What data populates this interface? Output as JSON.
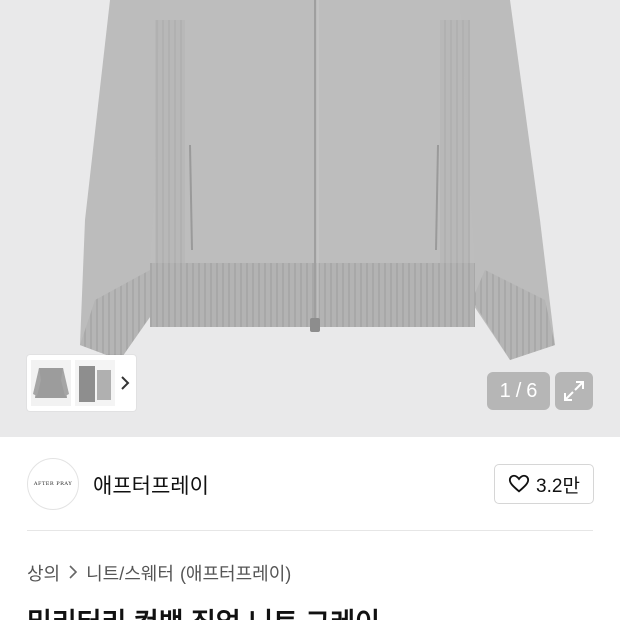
{
  "gallery": {
    "current": "1",
    "separator": "/",
    "total": "6"
  },
  "brand": {
    "name": "애프터프레이",
    "logo_text": "AFTER PRAY"
  },
  "like": {
    "count": "3.2만"
  },
  "breadcrumb": {
    "category": "상의",
    "subcategory": "니트/스웨터",
    "brand_tag": "(애프터프레이)"
  },
  "product": {
    "title": "밀리터리 컨백 집업 니트 그레이"
  },
  "icons": {
    "thumb_next": "chevron-right-icon",
    "expand": "expand-arrows-icon",
    "like": "heart-outline-icon",
    "breadcrumb_sep": "chevron-right-icon"
  },
  "colors": {
    "hero_background": "#e9e9ea",
    "sweater": "#b9b9b9",
    "overlay": "#787878"
  }
}
